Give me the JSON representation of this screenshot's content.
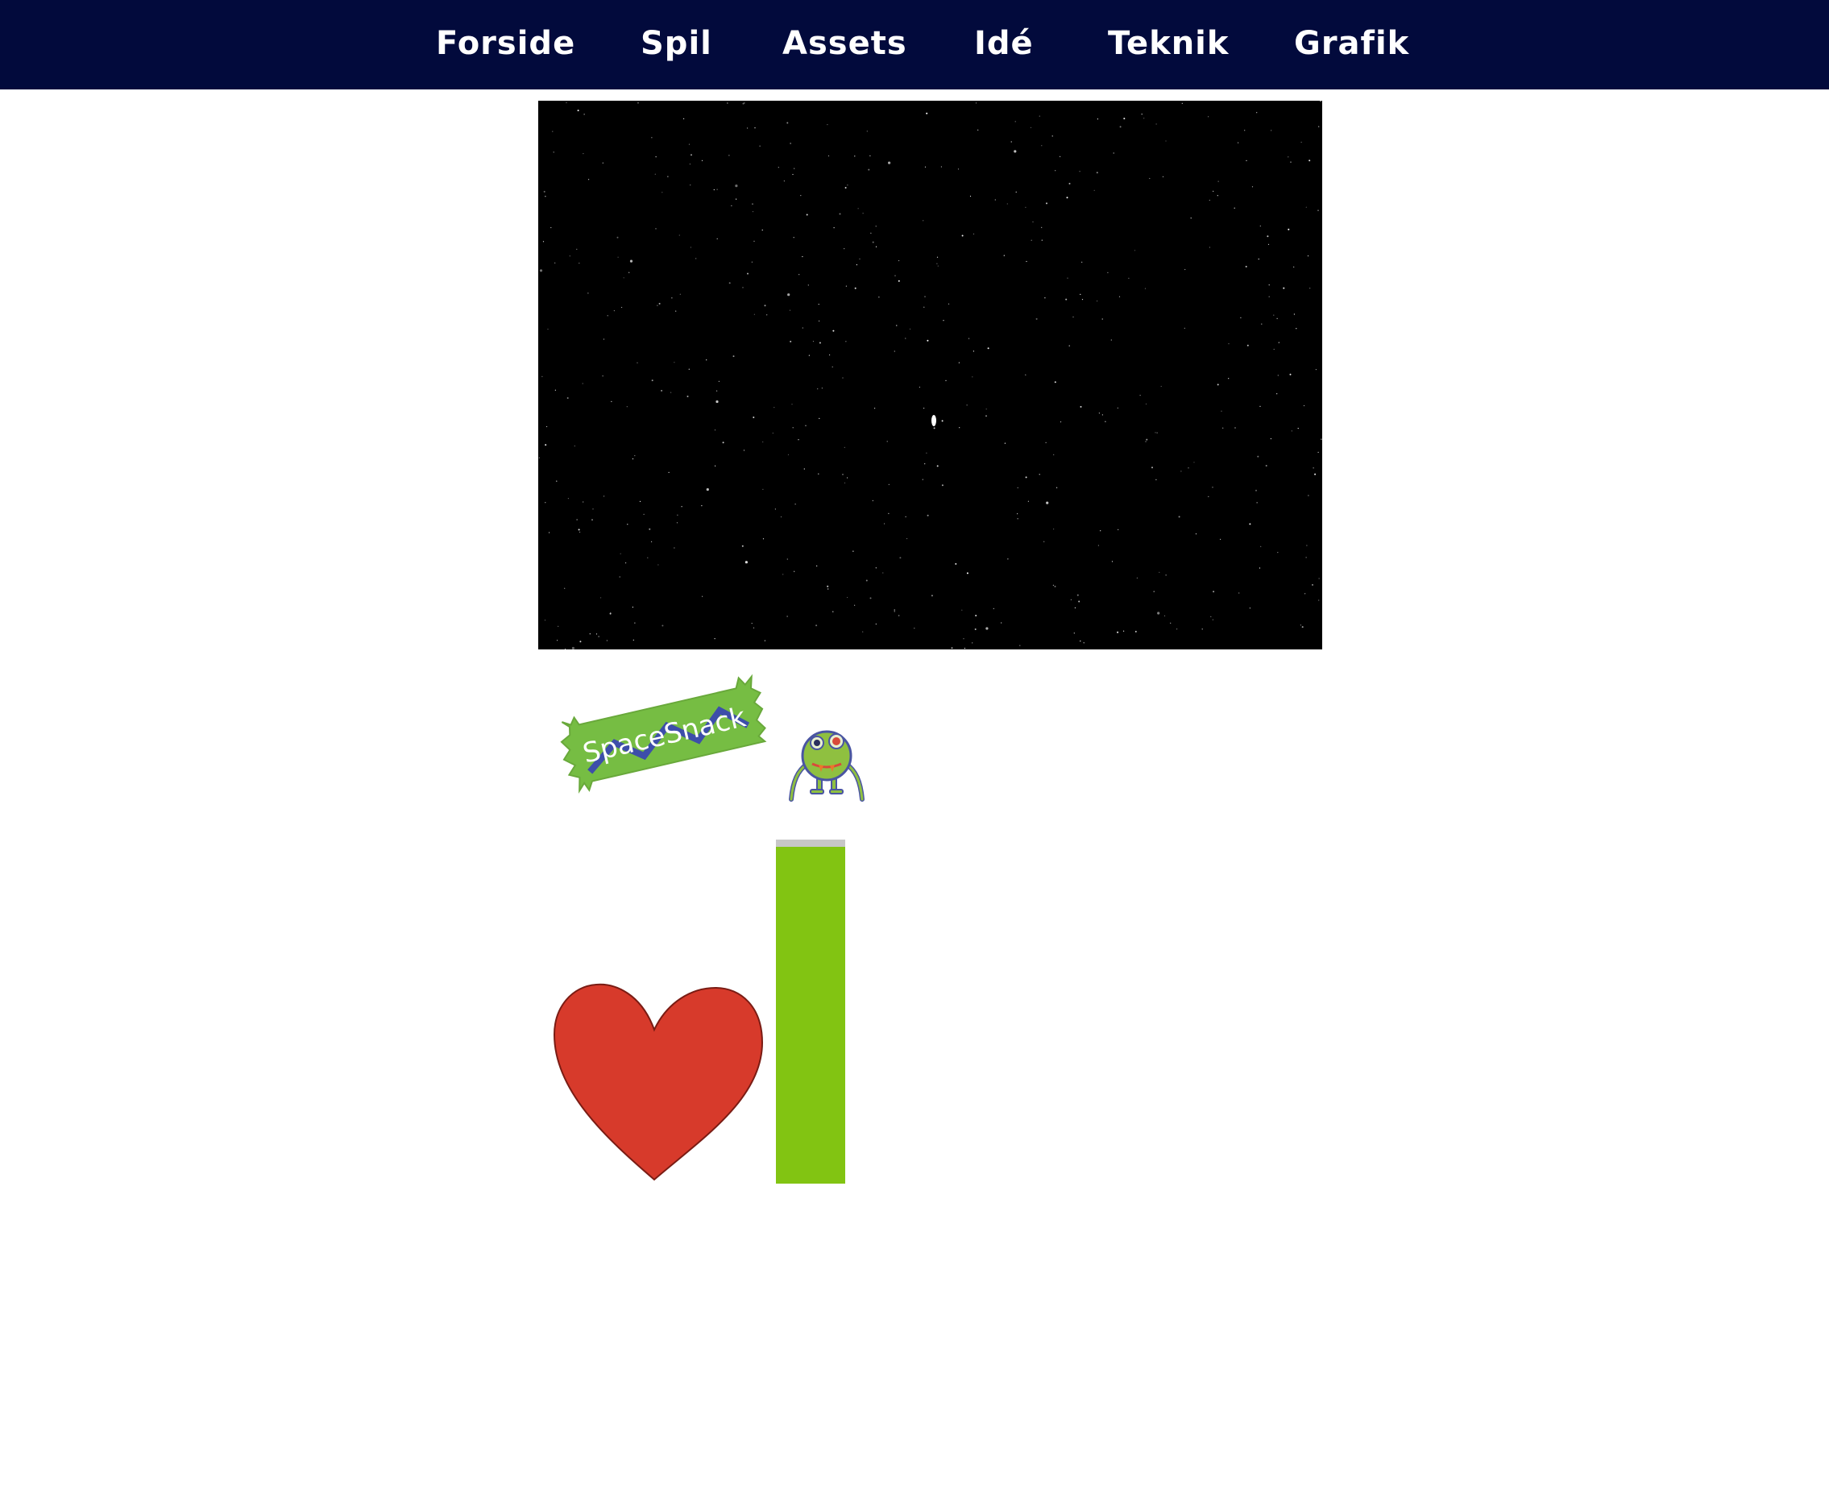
{
  "nav": {
    "items": [
      "Forside",
      "Spil",
      "Assets",
      "Idé",
      "Teknik",
      "Grafik"
    ]
  },
  "assets": {
    "snack_label": "SpaceSnack",
    "health_bar_level": 0.98
  },
  "colors": {
    "navbar": "#020a3c",
    "canvas": "#000000",
    "snack_green": "#76bd43",
    "snack_zigzag": "#3d4eaa",
    "monster_green": "#8fc040",
    "heart_red": "#d73a2b",
    "bar_green": "#82c412",
    "bar_track": "#c7c7c7"
  },
  "icons": [
    "space-snack-icon",
    "monster-icon",
    "heart-icon",
    "health-bar"
  ]
}
